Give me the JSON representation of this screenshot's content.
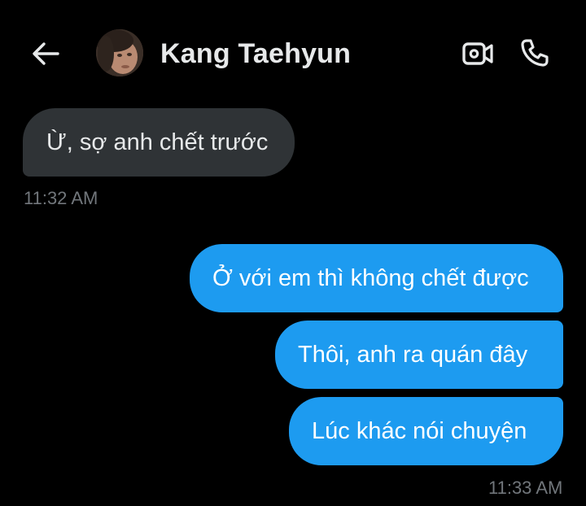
{
  "header": {
    "back_icon": "arrow-left-icon",
    "contact_name": "Kang Taehyun",
    "video_icon": "video-camera-icon",
    "call_icon": "phone-icon"
  },
  "messages": [
    {
      "direction": "incoming",
      "text": "Ừ, sợ anh chết trước"
    },
    {
      "direction": "outgoing",
      "text": "Ở với em thì không chết được"
    },
    {
      "direction": "outgoing",
      "text": "Thôi, anh ra quán đây"
    },
    {
      "direction": "outgoing",
      "text": "Lúc khác nói chuyện"
    }
  ],
  "timestamps": {
    "incoming": "11:32 AM",
    "outgoing": "11:33 AM"
  },
  "colors": {
    "background": "#000000",
    "incoming_bubble": "#2f3336",
    "outgoing_bubble": "#1d9bf0",
    "timestamp": "#71767b",
    "text": "#e7e9ea"
  }
}
